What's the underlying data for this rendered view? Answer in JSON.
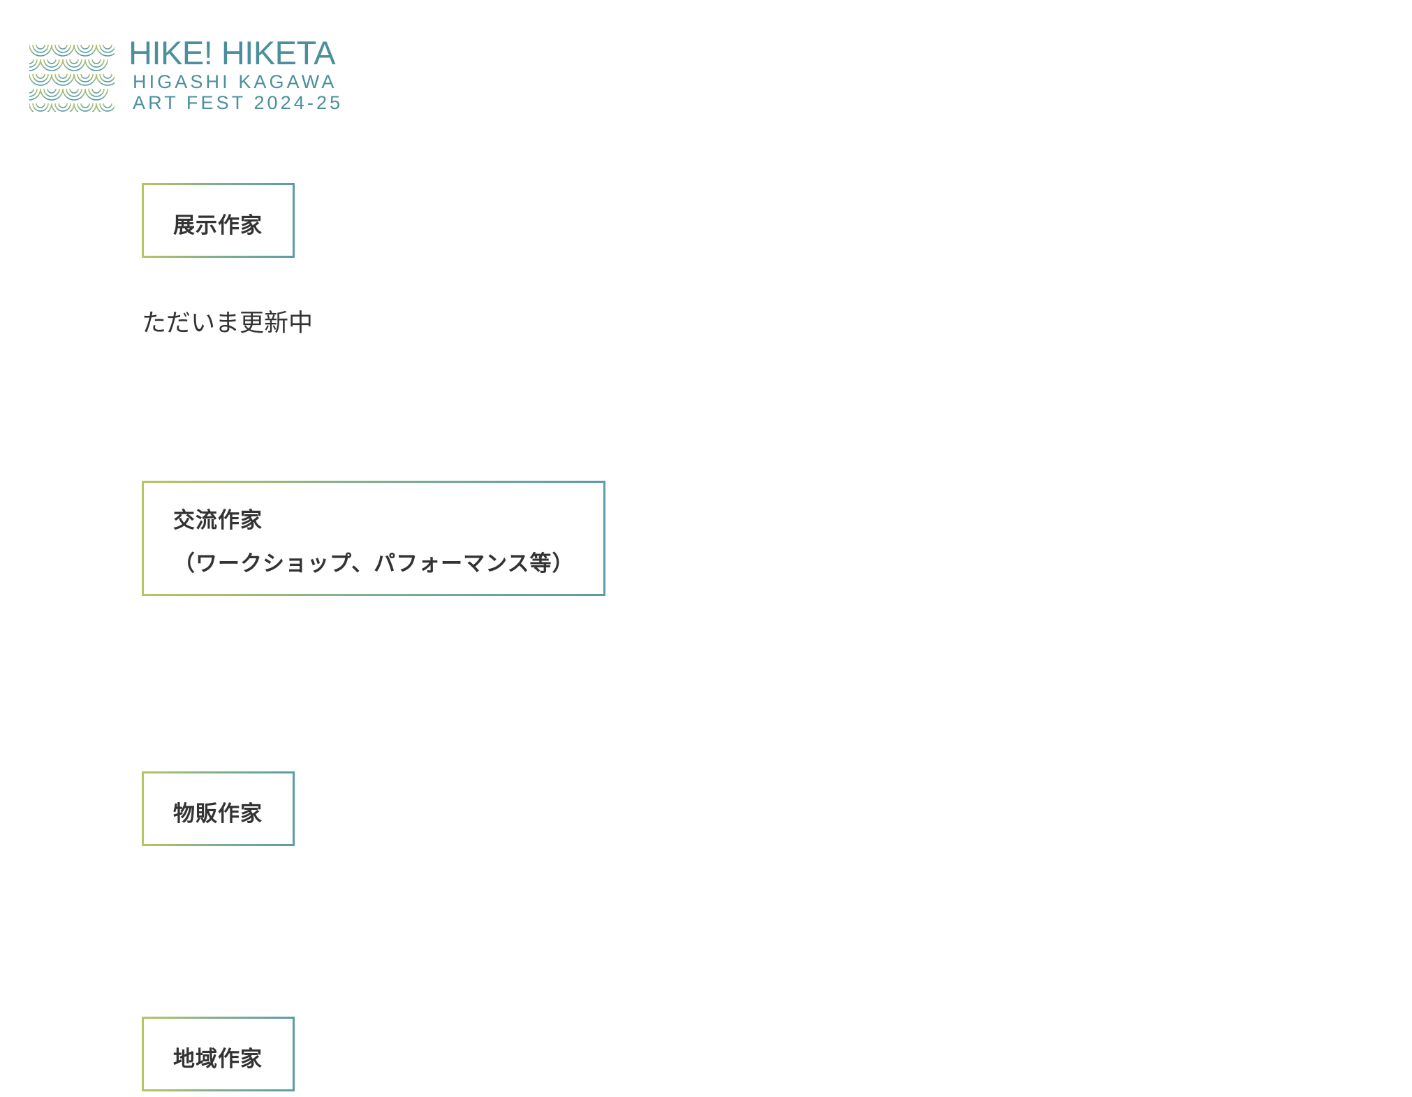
{
  "logo": {
    "title": "HIKE! HIKETA",
    "subtitle_line1": "HIGASHI KAGAWA",
    "subtitle_line2": "ART FEST 2024-25",
    "icon": "wave-scale-pattern-icon",
    "colors": {
      "text": "#4a8f9c",
      "gradient_start": "#b7c65e",
      "gradient_end": "#5a9ca7"
    }
  },
  "sections": {
    "exhibit": {
      "title": "展示作家",
      "status": "ただいま更新中"
    },
    "exchange": {
      "title_line1": "交流作家",
      "title_line2": "（ワークショップ、パフォーマンス等）"
    },
    "sales": {
      "title": "物販作家"
    },
    "local": {
      "title": "地域作家"
    }
  }
}
